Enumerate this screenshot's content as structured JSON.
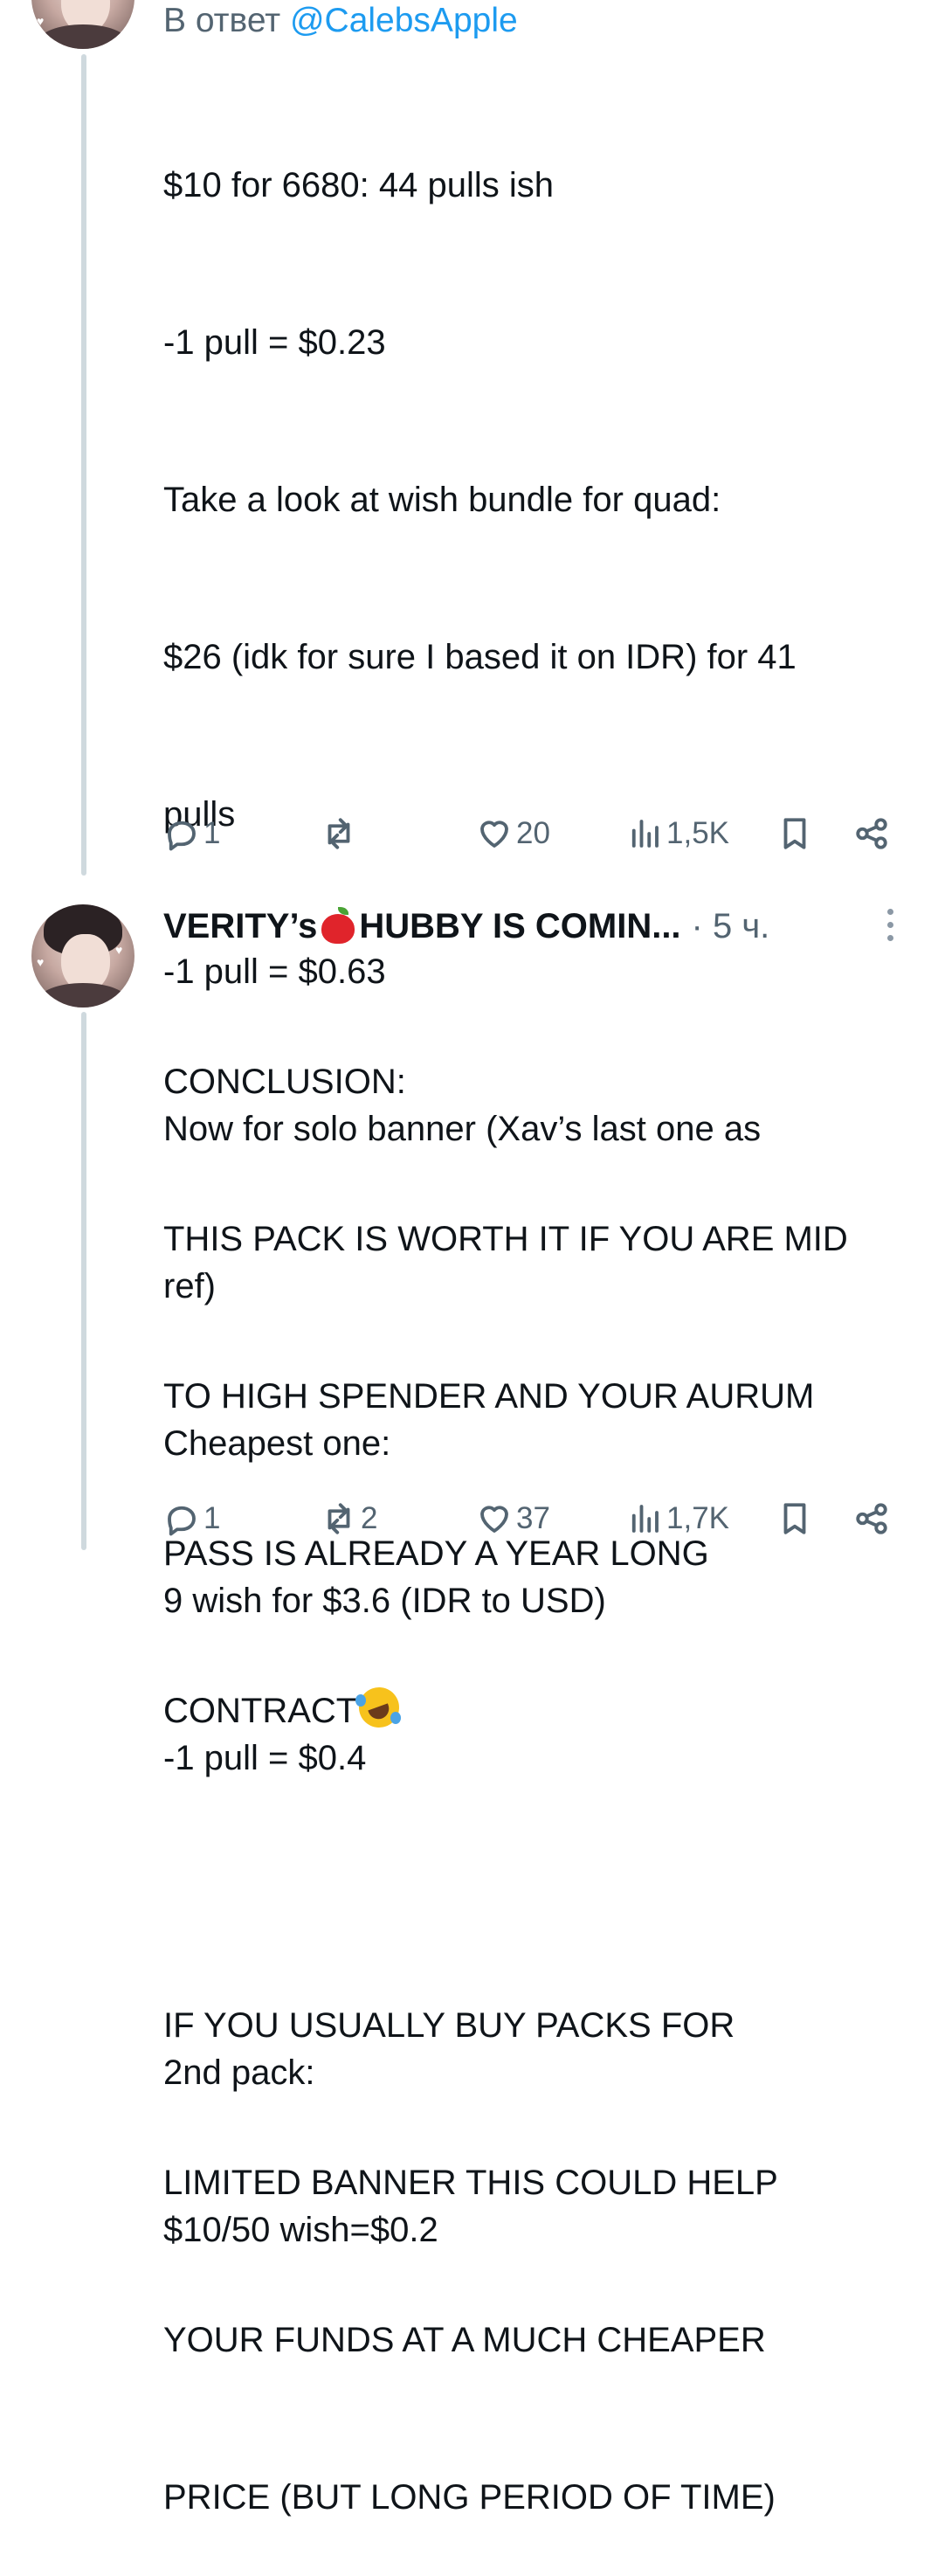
{
  "tweet1": {
    "reply_prefix": "В ответ",
    "reply_handle": "@CalebsApple",
    "lines": [
      "$10 for 6680: 44 pulls ish",
      "-1 pull = $0.23",
      "Take a look at wish bundle for quad:",
      "$26 (idk for sure I based it on IDR) for 41",
      "pulls",
      "-1 pull = $0.63",
      "Now for solo banner (Xav’s last one as",
      "ref)",
      "Cheapest one:",
      "9 wish for $3.6 (IDR to USD)",
      "-1 pull = $0.4",
      "",
      "2nd pack:",
      "$10/50 wish=$0.2"
    ],
    "actions": {
      "replies": "1",
      "retweets": "",
      "likes": "20",
      "views": "1,5K"
    }
  },
  "tweet2": {
    "name_part1": "VERITY’s",
    "name_emoji": "apple-emoji",
    "name_part2": "HUBBY IS COMIN...",
    "time": "· 5 ч.",
    "lines": [
      "CONCLUSION:",
      "THIS PACK IS WORTH IT IF YOU ARE MID",
      "TO HIGH SPENDER AND YOUR AURUM",
      "PASS IS ALREADY A YEAR LONG",
      "CONTRACT",
      "",
      "IF YOU USUALLY BUY PACKS FOR",
      "LIMITED BANNER THIS COULD HELP",
      "YOUR FUNDS AT A MUCH CHEAPER",
      "PRICE (BUT LONG PERIOD OF TIME)"
    ],
    "contract_emoji": "rolling-on-floor-laughing-emoji",
    "actions": {
      "replies": "1",
      "retweets": "2",
      "likes": "37",
      "views": "1,7K"
    }
  },
  "colors": {
    "text": "#0f1419",
    "muted": "#536471",
    "link": "#1d9bf0",
    "thread_line": "#cfd9de"
  }
}
